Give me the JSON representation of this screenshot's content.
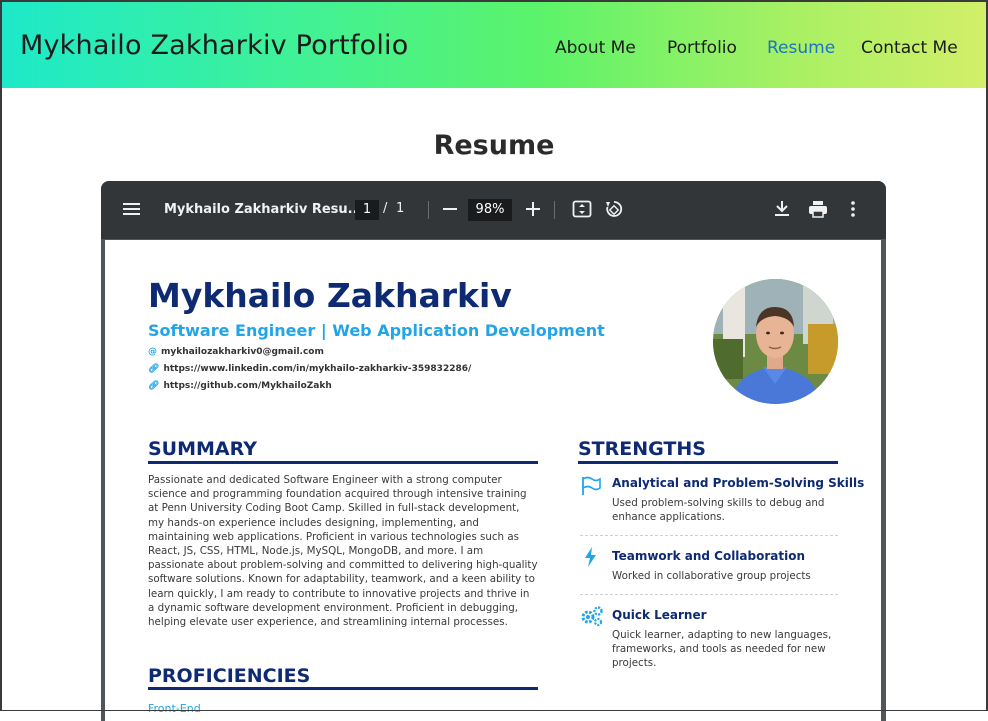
{
  "header": {
    "brand": "Mykhailo Zakharkiv Portfolio",
    "nav": [
      "About Me",
      "Portfolio",
      "Resume",
      "Contact Me"
    ],
    "active_nav": "Resume"
  },
  "page_title": "Resume",
  "viewer": {
    "doc_title": "Mykhailo Zakharkiv Resu...",
    "page_current": "1",
    "page_separator": "/",
    "page_total": "1",
    "zoom": "98%"
  },
  "resume": {
    "name": "Mykhailo Zakharkiv",
    "role": "Software Engineer | Web Application Development",
    "contacts": [
      {
        "icon": "at-icon",
        "text": "mykhailozakharkiv0@gmail.com"
      },
      {
        "icon": "link-icon",
        "text": "https://www.linkedin.com/in/mykhailo-zakharkiv-359832286/"
      },
      {
        "icon": "link-icon",
        "text": "https://github.com/MykhailoZakh"
      }
    ],
    "summary_title": "SUMMARY",
    "summary_text": "Passionate and dedicated  Software Engineer with a strong computer science and programming foundation acquired through intensive training at Penn University Coding Boot Camp. Skilled in full-stack development, my hands-on experience includes designing, implementing, and maintaining web applications. Proficient in various technologies such as React, JS, CSS, HTML, Node.js, MySQL, MongoDB, and more. I am passionate about problem-solving and committed to delivering high-quality software solutions. Known for adaptability, teamwork, and a keen ability to learn quickly, I am ready to contribute to innovative projects and thrive in a dynamic software development environment. Proficient in debugging, helping elevate user experience, and streamlining internal processes.",
    "strengths_title": "STRENGTHS",
    "strengths": [
      {
        "icon": "flag-icon",
        "title": "Analytical and Problem-Solving Skills",
        "desc": "Used problem-solving skills to debug and enhance applications."
      },
      {
        "icon": "bolt-icon",
        "title": "Teamwork and Collaboration",
        "desc": "Worked in collaborative group projects"
      },
      {
        "icon": "gears-icon",
        "title": "Quick Learner",
        "desc": "Quick learner, adapting to new languages, frameworks, and tools as needed for new projects."
      }
    ],
    "proficiencies_title": "PROFICIENCIES",
    "proficiencies_sub": "Front-End"
  },
  "colors": {
    "navy": "#0d2a72",
    "accent": "#22a5e6",
    "nav_active": "#1a73c8",
    "toolbar": "#323639"
  }
}
